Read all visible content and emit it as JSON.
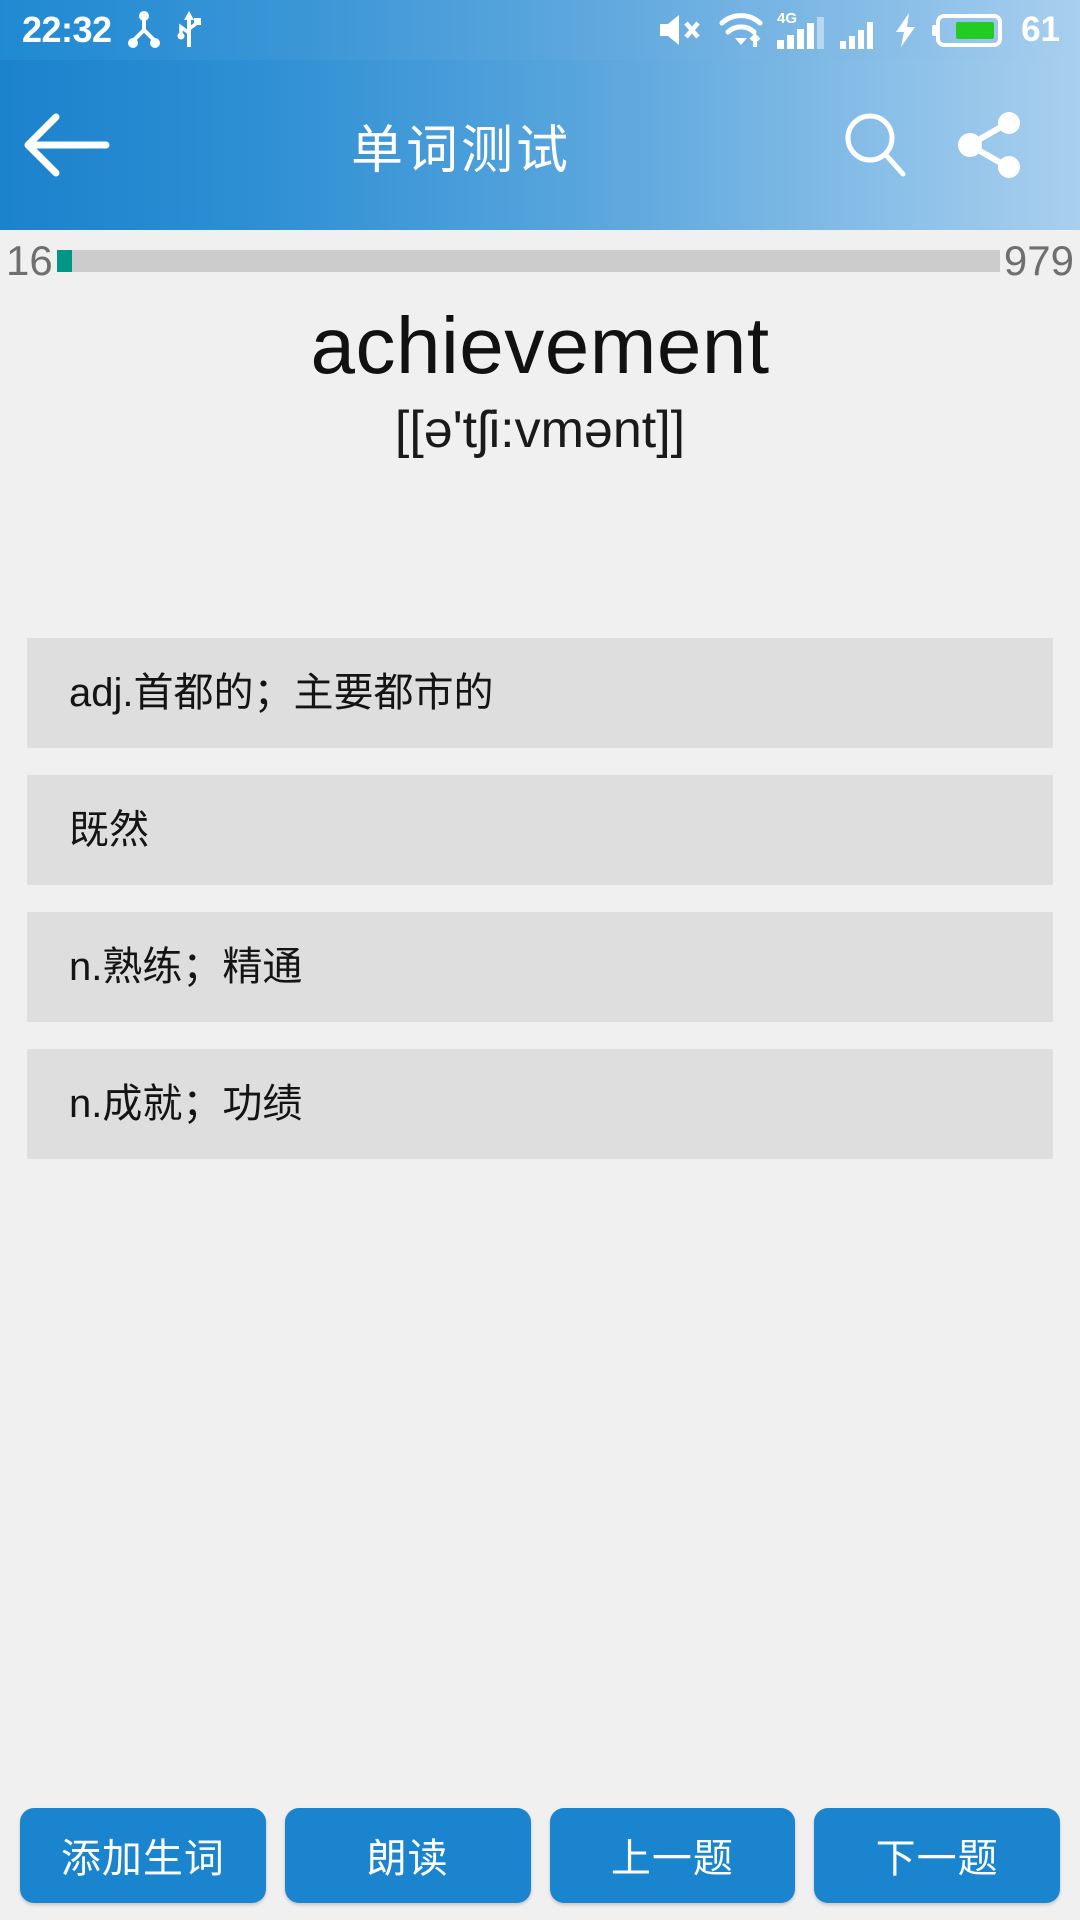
{
  "statusbar": {
    "time": "22:32",
    "battery_percent": "61",
    "icons": [
      "share-nodes-icon",
      "usb-icon",
      "volume-mute-icon",
      "wifi-icon",
      "signal-4g-icon",
      "signal-bars-icon",
      "charging-bolt-icon",
      "battery-icon"
    ],
    "network_label": "4G",
    "colors": {
      "battery_fill": "#22cc22",
      "bar_start": "#1f8ad2",
      "bar_end": "#a9cfee"
    }
  },
  "appbar": {
    "title": "单词测试",
    "back_icon": "arrow-left-icon",
    "search_icon": "search-icon",
    "share_icon": "share-icon"
  },
  "progress": {
    "current": "16",
    "total": "979",
    "percent": 1.6,
    "fill_color": "#009688",
    "track_color": "#cccccc"
  },
  "word": {
    "term": "achievement",
    "phonetic": "[[ə'tʃi:vmənt]]"
  },
  "options": [
    {
      "text": "adj.首都的；主要都市的"
    },
    {
      "text": "既然"
    },
    {
      "text": "n.熟练；精通"
    },
    {
      "text": "n.成就；功绩"
    }
  ],
  "bottom_buttons": [
    {
      "label": "添加生词"
    },
    {
      "label": "朗读"
    },
    {
      "label": "上一题"
    },
    {
      "label": "下一题"
    }
  ]
}
